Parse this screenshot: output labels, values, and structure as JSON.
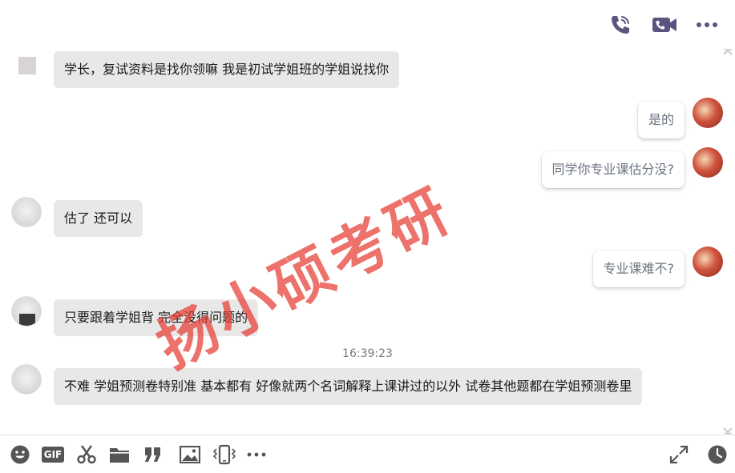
{
  "header": {
    "call_icon": "phone-icon",
    "video_icon": "video-call-icon",
    "more_icon": "more-icon",
    "accent_color": "#5b5480"
  },
  "messages": [
    {
      "side": "left",
      "text": "学长，复试资料是找你领嘛  我是初试学姐班的学姐说找你"
    },
    {
      "side": "right",
      "text": "是的"
    },
    {
      "side": "right",
      "text": "同学你专业课估分没?"
    },
    {
      "side": "left",
      "text": "估了 还可以"
    },
    {
      "side": "right",
      "text": "专业课难不?"
    },
    {
      "side": "left",
      "text": "只要跟着学姐背  完全没得问题的"
    },
    {
      "side": "left",
      "text": "不难  学姐预测卷特别准  基本都有  好像就两个名词解释上课讲过的以外  试卷其他题都在学姐预测卷里"
    }
  ],
  "timestamp": "16:39:23",
  "watermark": "扬小硕考研",
  "toolbar": {
    "icons": [
      "emoji-icon",
      "gif-icon",
      "scissors-icon",
      "folder-icon",
      "quote-icon",
      "image-icon",
      "shake-icon",
      "more-icon"
    ],
    "right_icons": [
      "expand-icon",
      "history-clock-icon"
    ],
    "gif_label": "GIF",
    "icon_color": "#555555"
  }
}
